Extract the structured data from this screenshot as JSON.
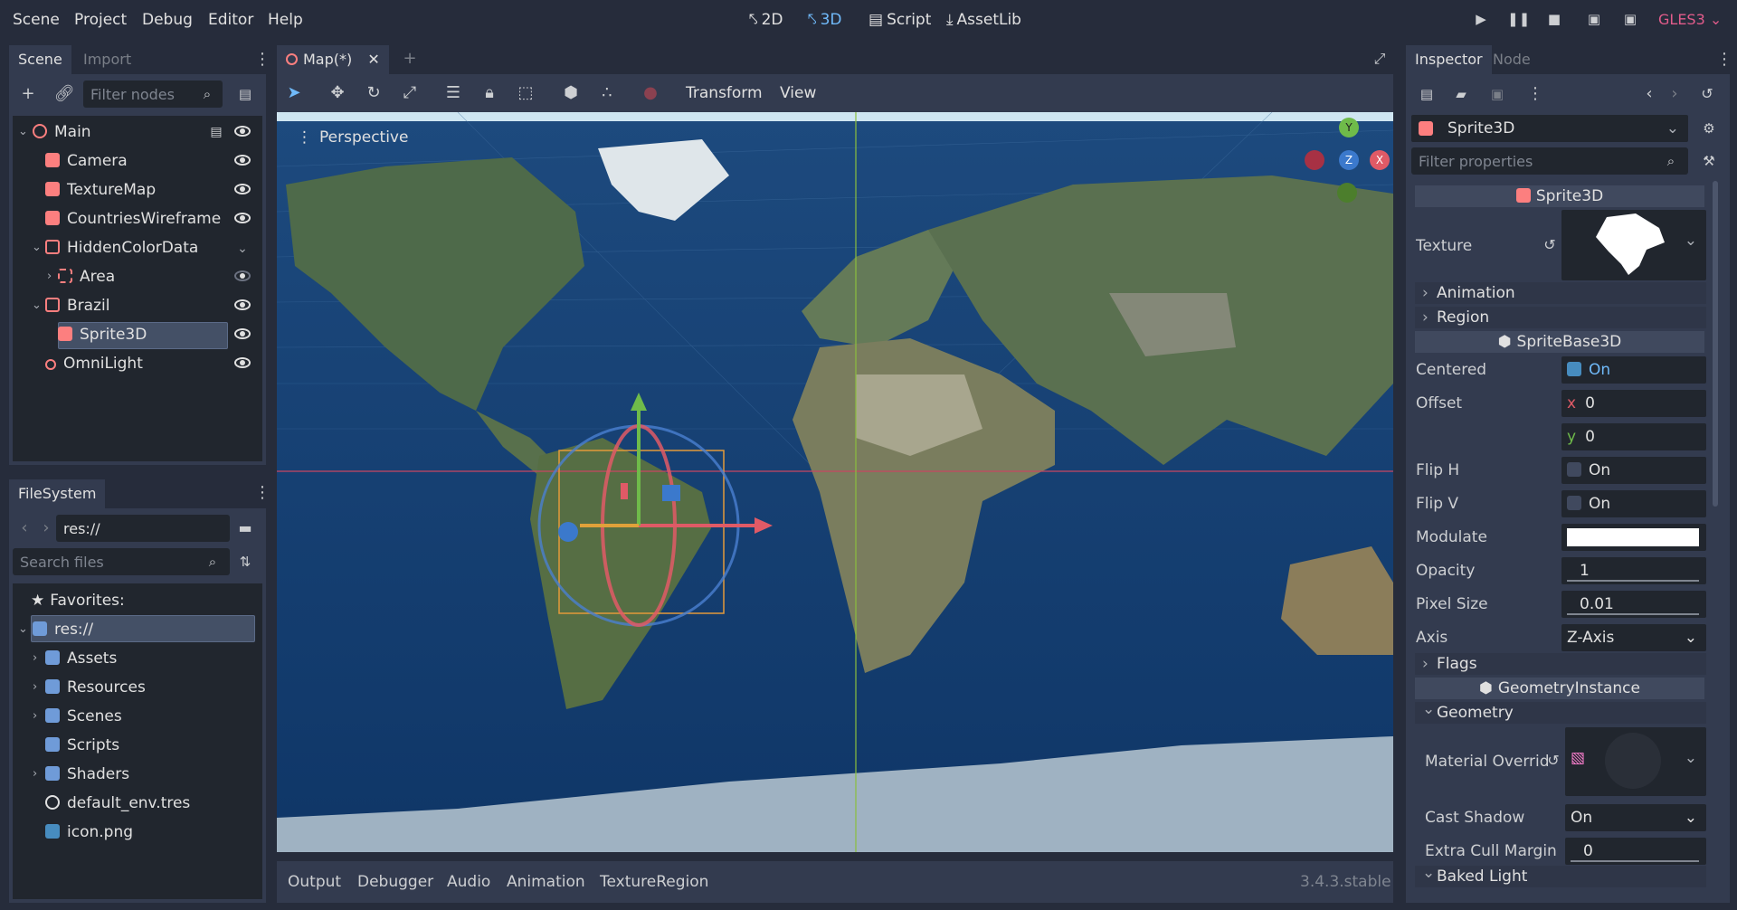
{
  "menu": [
    "Scene",
    "Project",
    "Debug",
    "Editor",
    "Help"
  ],
  "modes": {
    "m2d": "2D",
    "m3d": "3D",
    "script": "Script",
    "assetlib": "AssetLib"
  },
  "renderer": "GLES3",
  "scene_panel": {
    "tabs": [
      "Scene",
      "Import"
    ],
    "filter_placeholder": "Filter nodes",
    "nodes": [
      {
        "label": "Main",
        "color": "#fc7f7f"
      },
      {
        "label": "Camera",
        "color": "#fc7f7f"
      },
      {
        "label": "TextureMap",
        "color": "#fc7f7f"
      },
      {
        "label": "CountriesWireframe",
        "color": "#fc7f7f"
      },
      {
        "label": "HiddenColorData",
        "color": "#fc7f7f"
      },
      {
        "label": "Area",
        "color": "#fc7f7f"
      },
      {
        "label": "Brazil",
        "color": "#fc7f7f"
      },
      {
        "label": "Sprite3D",
        "color": "#fc7f7f"
      },
      {
        "label": "OmniLight",
        "color": "#fc7f7f"
      }
    ]
  },
  "filesystem": {
    "title": "FileSystem",
    "path": "res://",
    "search_placeholder": "Search files",
    "favorites": "Favorites:",
    "root": "res://",
    "items": [
      "Assets",
      "Resources",
      "Scenes",
      "Scripts",
      "Shaders",
      "default_env.tres",
      "icon.png"
    ]
  },
  "editor": {
    "tab": "Map(*)",
    "toolbar_menus": [
      "Transform",
      "View"
    ],
    "viewport_label": "Perspective",
    "gizmo_axes": {
      "y": "Y",
      "z": "Z",
      "x": "X"
    }
  },
  "bottom_tabs": [
    "Output",
    "Debugger",
    "Audio",
    "Animation",
    "TextureRegion"
  ],
  "version": "3.4.3.stable",
  "inspector": {
    "tabs": [
      "Inspector",
      "Node"
    ],
    "object": "Sprite3D",
    "filter_placeholder": "Filter properties",
    "section_sprite3d": "Sprite3D",
    "texture_label": "Texture",
    "animation": "Animation",
    "region": "Region",
    "section_spritebase": "SpriteBase3D",
    "centered": {
      "label": "Centered",
      "value": "On"
    },
    "offset": {
      "label": "Offset",
      "x_label": "x",
      "x": "0",
      "y_label": "y",
      "y": "0"
    },
    "flip_h": {
      "label": "Flip H",
      "value": "On"
    },
    "flip_v": {
      "label": "Flip V",
      "value": "On"
    },
    "modulate": {
      "label": "Modulate",
      "color": "#ffffff"
    },
    "opacity": {
      "label": "Opacity",
      "value": "1"
    },
    "pixel_size": {
      "label": "Pixel Size",
      "value": "0.01"
    },
    "axis": {
      "label": "Axis",
      "value": "Z-Axis"
    },
    "flags": "Flags",
    "section_geometry": "GeometryInstance",
    "geometry": "Geometry",
    "material_override": "Material Overrid",
    "cast_shadow": {
      "label": "Cast Shadow",
      "value": "On"
    },
    "extra_cull": {
      "label": "Extra Cull Margin",
      "value": "0"
    },
    "baked_light": "Baked Light"
  }
}
